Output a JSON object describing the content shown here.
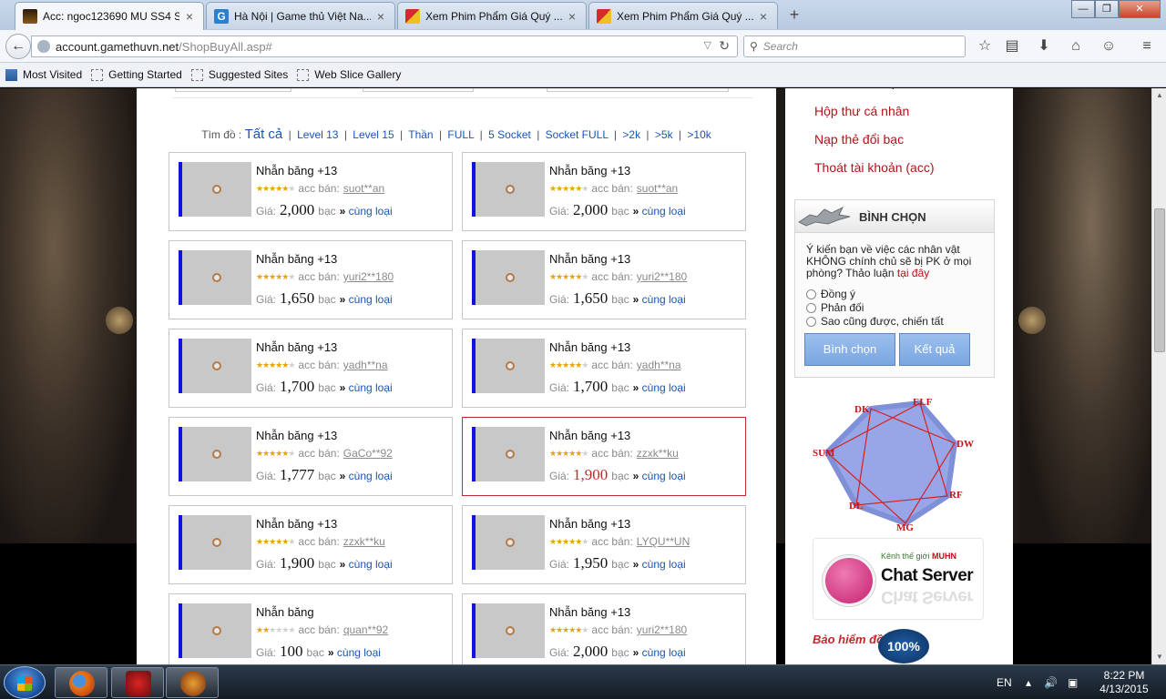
{
  "browser": {
    "tabs": [
      {
        "title": "Acc: ngoc123690 MU SS4 S...",
        "active": true
      },
      {
        "title": "Hà Nội | Game thủ Việt Na...",
        "active": false
      },
      {
        "title": "Xem Phim Phẩm Giá Quý ...",
        "active": false
      },
      {
        "title": "Xem Phim Phẩm Giá Quý ...",
        "active": false
      }
    ],
    "url_host": "account.gamethuvn.net",
    "url_path": "/ShopBuyAll.asp#",
    "search_placeholder": "Search",
    "bookmarks": [
      "Most Visited",
      "Getting Started",
      "Suggested Sites",
      "Web Slice Gallery"
    ]
  },
  "filter": {
    "label": "Tìm đồ :",
    "all": "Tất cả",
    "links": [
      "Level 13",
      "Level 15",
      "Thần",
      "FULL",
      "5 Socket",
      "Socket FULL",
      ">2k",
      ">5k",
      ">10k"
    ]
  },
  "item_labels": {
    "seller": "acc bán:",
    "price": "Giá:",
    "currency": "bạc",
    "same_type": "cùng loại",
    "raquo": "»"
  },
  "items": [
    {
      "name": "Nhẫn băng +13",
      "seller": "suot**an",
      "price": "2,000",
      "stars": 5,
      "highlight": false
    },
    {
      "name": "Nhẫn băng +13",
      "seller": "suot**an",
      "price": "2,000",
      "stars": 5,
      "highlight": false
    },
    {
      "name": "Nhẫn băng +13",
      "seller": "yuri2**180",
      "price": "1,650",
      "stars": 5,
      "highlight": false
    },
    {
      "name": "Nhẫn băng +13",
      "seller": "yuri2**180",
      "price": "1,650",
      "stars": 5,
      "highlight": false
    },
    {
      "name": "Nhẫn băng +13",
      "seller": "yadh**na",
      "price": "1,700",
      "stars": 5,
      "highlight": false
    },
    {
      "name": "Nhẫn băng +13",
      "seller": "yadh**na",
      "price": "1,700",
      "stars": 5,
      "highlight": false
    },
    {
      "name": "Nhẫn băng +13",
      "seller": "GaCo**92",
      "price": "1,777",
      "stars": 5,
      "highlight": false
    },
    {
      "name": "Nhẫn băng +13",
      "seller": "zzxk**ku",
      "price": "1,900",
      "stars": 5,
      "highlight": true
    },
    {
      "name": "Nhẫn băng +13",
      "seller": "zzxk**ku",
      "price": "1,900",
      "stars": 5,
      "highlight": false
    },
    {
      "name": "Nhẫn băng +13",
      "seller": "LYQU**UN",
      "price": "1,950",
      "stars": 5,
      "highlight": false
    },
    {
      "name": "Nhẫn băng",
      "seller": "quan**92",
      "price": "100",
      "stars": 2,
      "highlight": false
    },
    {
      "name": "Nhẫn băng +13",
      "seller": "yuri2**180",
      "price": "2,000",
      "stars": 5,
      "highlight": false
    }
  ],
  "sidebar": {
    "links": [
      "Reset nhân vật",
      "Hộp thư cá nhân",
      "Nạp thẻ đổi bạc",
      "Thoát tài khoản (acc)"
    ],
    "vote": {
      "title": "BÌNH CHỌN",
      "question": "Ý kiến bạn về việc các nhân vật KHÔNG chính chủ sẽ bị PK ở mọi phòng? Thảo luận",
      "question_link": "tại đây",
      "options": [
        "Đồng ý",
        "Phản đối",
        "Sao cũng được, chiến tất"
      ],
      "vote_button": "Bình chọn",
      "result_button": "Kết quả"
    },
    "classes": [
      "DK",
      "ELF",
      "DW",
      "RF",
      "MG",
      "DL",
      "SUM"
    ],
    "chat": {
      "subtitle": "Kênh thế giới",
      "brand": "MUHN",
      "title": "Chat Server"
    },
    "insurance": {
      "text": "Bảo hiểm đồ",
      "badge": "100%"
    }
  },
  "taskbar": {
    "language": "EN",
    "time": "8:22 PM",
    "date": "4/13/2015"
  },
  "colors": {
    "link_blue": "#1a55b5",
    "sidebar_red": "#b3121a",
    "highlight_red": "#c0292b",
    "item_bar": "#1212e0"
  }
}
